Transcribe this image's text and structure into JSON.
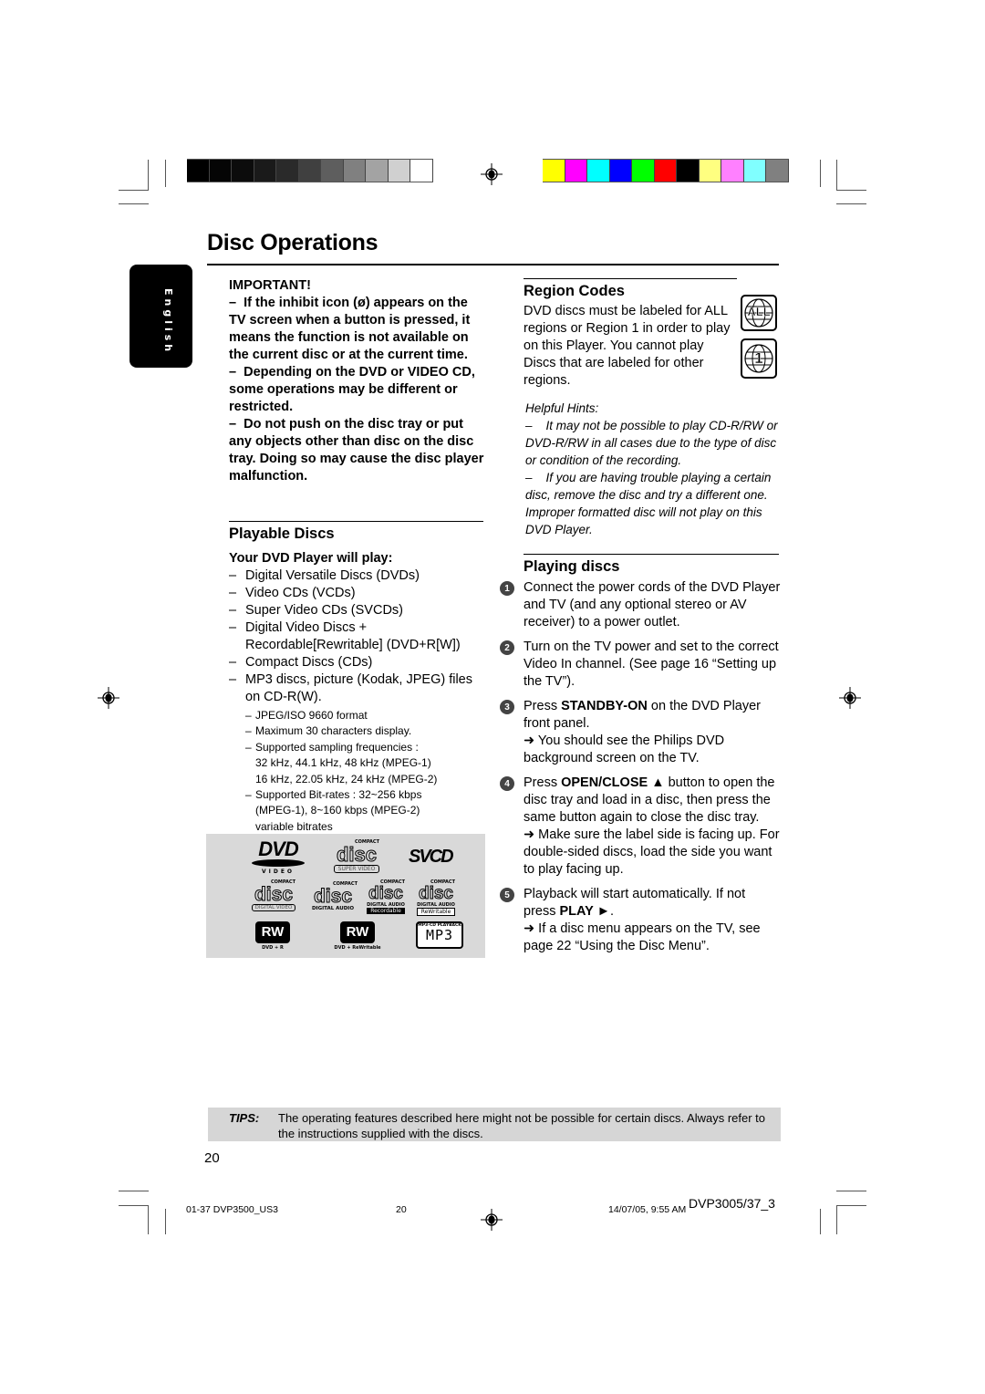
{
  "page_title": "Disc Operations",
  "language_tab": "English",
  "grayscale_swatches": [
    "#000000",
    "#050505",
    "#0c0c0c",
    "#1a1a1a",
    "#2a2a2a",
    "#404040",
    "#5e5e5e",
    "#808080",
    "#a3a3a3",
    "#d0d0d0",
    "#ffffff"
  ],
  "color_swatches": [
    "#ffff00",
    "#ff00ff",
    "#00ffff",
    "#0000ff",
    "#00ff00",
    "#ff0000",
    "#000000",
    "#ffff80",
    "#ff80ff",
    "#80ffff",
    "#808080"
  ],
  "important": {
    "heading": "IMPORTANT!",
    "items": [
      "If the inhibit icon (ø) appears on the TV screen when a button is pressed, it means the function is not available on the current disc or at the current time.",
      "Depending on the DVD or VIDEO CD, some operations may be different or restricted.",
      "Do not push on the disc tray or put any objects other than disc on the disc tray.  Doing so may cause the disc player malfunction."
    ]
  },
  "playable_discs": {
    "heading": "Playable Discs",
    "subheading": "Your DVD Player will play:",
    "items": [
      "Digital Versatile Discs (DVDs)",
      "Video CDs (VCDs)",
      "Super Video CDs (SVCDs)",
      "Digital Video Discs + Recordable[Rewritable] (DVD+R[W])",
      "Compact Discs (CDs)",
      "MP3 discs, picture (Kodak, JPEG) files on CD-R(W)."
    ],
    "sub_items": [
      "JPEG/ISO 9660 format",
      "Maximum 30 characters display.",
      "Supported sampling frequencies :",
      "Supported Bit-rates : 32~256 kbps"
    ],
    "sampling_line_1": "32 kHz, 44.1 kHz, 48 kHz (MPEG-1)",
    "sampling_line_2": "16 kHz, 22.05 kHz, 24 kHz (MPEG-2)",
    "bitrate_line_1": "(MPEG-1), 8~160 kbps (MPEG-2)",
    "bitrate_line_2": "variable bitrates"
  },
  "logos": {
    "dvd_video": "VIDEO",
    "compact": "COMPACT",
    "disc": "disc",
    "super_video": "SUPER VIDEO",
    "svcd": "SVCD",
    "digital_video": "DIGITAL VIDEO",
    "digital_audio": "DIGITAL AUDIO",
    "recordable": "Recordable",
    "rewritable": "ReWritable",
    "rw": "RW",
    "dvd_r": "DVD + R",
    "dvd_rw": "DVD + ReWritable",
    "mp3_header": "MP3-CD PLAYBACK",
    "mp3": "MP3"
  },
  "region_codes": {
    "heading": "Region Codes",
    "text": "DVD discs must be labeled for ALL regions or Region 1 in order to play on this Player. You cannot play Discs that are labeled for other regions.",
    "icon_all": "ALL",
    "icon_one": "1"
  },
  "helpful_hints": {
    "heading": "Helpful Hints:",
    "items": [
      "It may not be possible to play CD-R/RW or DVD-R/RW in all cases due to the type of disc or condition of the recording.",
      "If you are having trouble playing a certain disc, remove the disc and try a different one. Improper formatted disc will not play on this DVD Player."
    ]
  },
  "playing_discs": {
    "heading": "Playing discs",
    "steps": [
      {
        "num": "1",
        "pre": "Connect the power cords of the DVD Player and TV (and any optional stereo or AV receiver) to a power outlet.",
        "bold": "",
        "post": "",
        "result": ""
      },
      {
        "num": "2",
        "pre": "Turn on the TV power and set to the correct Video In channel.  (See page 16 “Setting up the TV”).",
        "bold": "",
        "post": "",
        "result": ""
      },
      {
        "num": "3",
        "pre": "Press ",
        "bold": "STANDBY-ON",
        "post": " on the DVD Player front panel.",
        "result": "➜ You should see the Philips DVD background screen on the TV."
      },
      {
        "num": "4",
        "pre": "Press ",
        "bold": "OPEN/CLOSE ▲",
        "post": " button to open the disc tray and load in a disc, then press the same button again to close the disc tray.",
        "result": "➜ Make sure the label side is facing up. For double-sided discs, load the side you want to play facing up."
      },
      {
        "num": "5",
        "pre": "Playback will start automatically. If not press ",
        "bold": "PLAY ►",
        "post": ".",
        "result": "➜ If a disc menu appears on the TV, see page 22 “Using the Disc Menu”."
      }
    ]
  },
  "tips": {
    "label": "TIPS:",
    "text": "The operating features described here might not be possible for certain discs.  Always refer to the instructions supplied with the discs."
  },
  "page_number": "20",
  "footer": {
    "file": "01-37 DVP3500_US3",
    "page": "20",
    "date": "14/07/05, 9:55 AM",
    "model": "DVP3005/37_3"
  }
}
